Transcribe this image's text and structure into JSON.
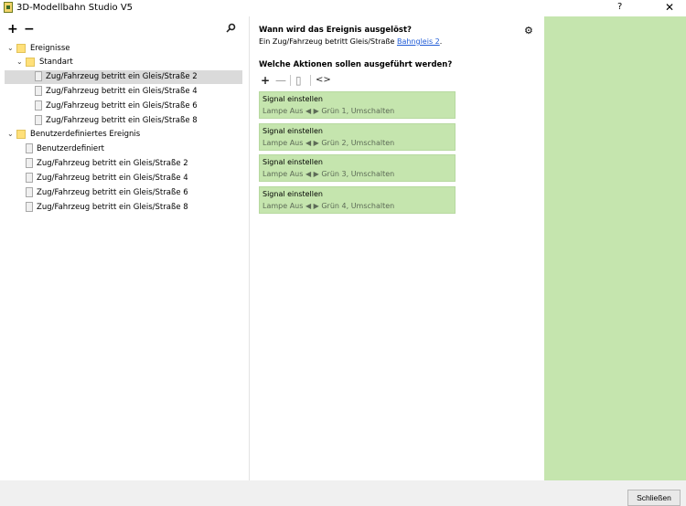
{
  "window": {
    "title": "3D-Modellbahn Studio V5",
    "help_label": "?",
    "close_label": "✕"
  },
  "left_toolbar": {
    "add_label": "+",
    "remove_label": "−"
  },
  "tree": {
    "root_label": "Ereignisse",
    "groups": [
      {
        "label": "Standart",
        "items": [
          "Zug/Fahrzeug betritt ein Gleis/Straße 2",
          "Zug/Fahrzeug betritt ein Gleis/Straße 4",
          "Zug/Fahrzeug betritt ein Gleis/Straße 6",
          "Zug/Fahrzeug betritt ein Gleis/Straße 8"
        ]
      },
      {
        "label": "Benutzerdefiniertes Ereignis",
        "items": [
          "Benutzerdefiniert",
          "Zug/Fahrzeug betritt ein Gleis/Straße 2",
          "Zug/Fahrzeug betritt ein Gleis/Straße 4",
          "Zug/Fahrzeug betritt ein Gleis/Straße 6",
          "Zug/Fahrzeug betritt ein Gleis/Straße 8"
        ]
      }
    ]
  },
  "event": {
    "question": "Wann wird das Ereignis ausgelöst?",
    "trigger_prefix": "Ein Zug/Fahrzeug betritt Gleis/Straße ",
    "trigger_link": "Bahngleis 2",
    "trigger_suffix": ".",
    "gear_label": "⚙"
  },
  "actions": {
    "question": "Welche Aktionen sollen ausgeführt werden?",
    "toolbar": {
      "add_label": "+",
      "remove_label": "—",
      "copy_label": "▯",
      "code_label": "<>"
    },
    "items": [
      {
        "title": "Signal einstellen",
        "detail": "Lampe Aus ◀ ▶ Grün 1, Umschalten"
      },
      {
        "title": "Signal einstellen",
        "detail": "Lampe Aus ◀ ▶ Grün 2, Umschalten"
      },
      {
        "title": "Signal einstellen",
        "detail": "Lampe Aus ◀ ▶ Grün 3, Umschalten"
      },
      {
        "title": "Signal einstellen",
        "detail": "Lampe Aus ◀ ▶ Grün 4, Umschalten"
      }
    ]
  },
  "footer": {
    "close_button": "Schließen"
  },
  "colors": {
    "accent_green": "#c5e5ae",
    "selection": "#dadada"
  }
}
